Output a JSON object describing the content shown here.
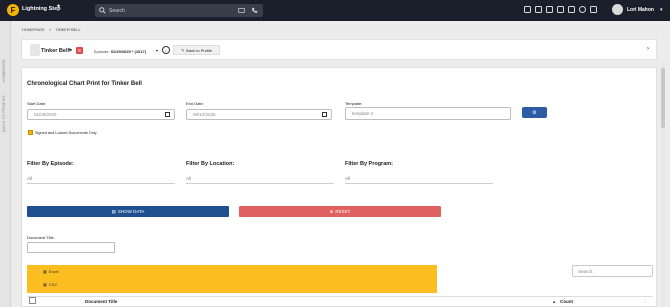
{
  "app": {
    "name": "Lightning Step",
    "logo_letter": "F"
  },
  "search": {
    "placeholder": "Search"
  },
  "user": {
    "name": "Lori Mahon"
  },
  "sidebar": {
    "homepage": "HOMEPAGE",
    "back": "BACK TO PROFILE"
  },
  "breadcrumb": {
    "home": "HOMEPAGE",
    "sep": ">",
    "current": "TINKER BELL"
  },
  "patient": {
    "name": "Tinker Bell",
    "badge": "8",
    "episode_label": "Episode:",
    "episode_value": "01/29/2025 * (1017)",
    "info": "i",
    "back_button": "Back to Profile"
  },
  "form": {
    "title": "Chronological Chart Print for Tinker Bell",
    "start_label": "Start Date:",
    "start_value": "01/29/2025",
    "end_label": "End Date:",
    "end_value": "08/12/2025",
    "template_label": "Template:",
    "template_value": "template 2",
    "checkbox_label": "Signed and Locked Documents Only",
    "filter_episode_label": "Filter By Episode:",
    "filter_episode_value": "All",
    "filter_location_label": "Filter By Location:",
    "filter_location_value": "All",
    "filter_program_label": "Filter By Program:",
    "filter_program_value": "All",
    "show_button": "SHOW DATA",
    "reset_button": "RESET",
    "doc_title_label": "Document Title:"
  },
  "export": {
    "excel": "Excel",
    "csv": "CSV"
  },
  "table": {
    "search_placeholder": "Search:",
    "col_title": "Document Title",
    "col_count": "Count"
  },
  "colors": {
    "topbar": "#1b1e2b",
    "accent": "#f5b400",
    "primary": "#1f4f91",
    "danger": "#e06161"
  }
}
